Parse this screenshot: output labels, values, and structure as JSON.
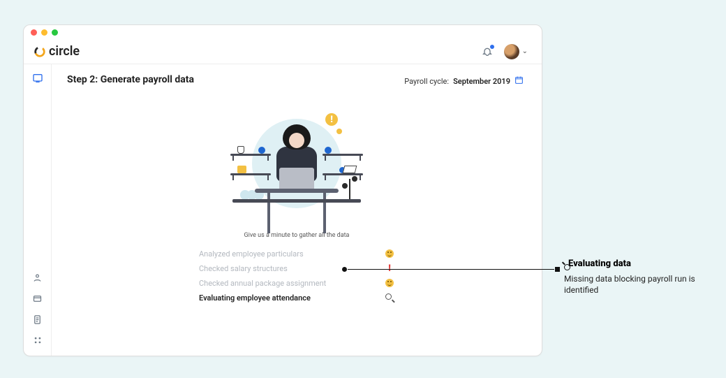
{
  "brand": {
    "name": "circle"
  },
  "header": {
    "step_title": "Step 2: Generate payroll data",
    "cycle_label": "Payroll cycle:",
    "cycle_value": "September 2019"
  },
  "illustration": {
    "caption": "Give us a minute to gather all the data"
  },
  "checks": [
    {
      "label": "Analyzed employee particulars",
      "status": "ok"
    },
    {
      "label": "Checked salary structures",
      "status": "warn"
    },
    {
      "label": "Checked annual package assignment",
      "status": "ok"
    },
    {
      "label": "Evaluating employee attendance",
      "status": "loading"
    }
  ],
  "annotation": {
    "title": "Evaluating data",
    "body": "Missing data blocking payroll run is identified"
  }
}
